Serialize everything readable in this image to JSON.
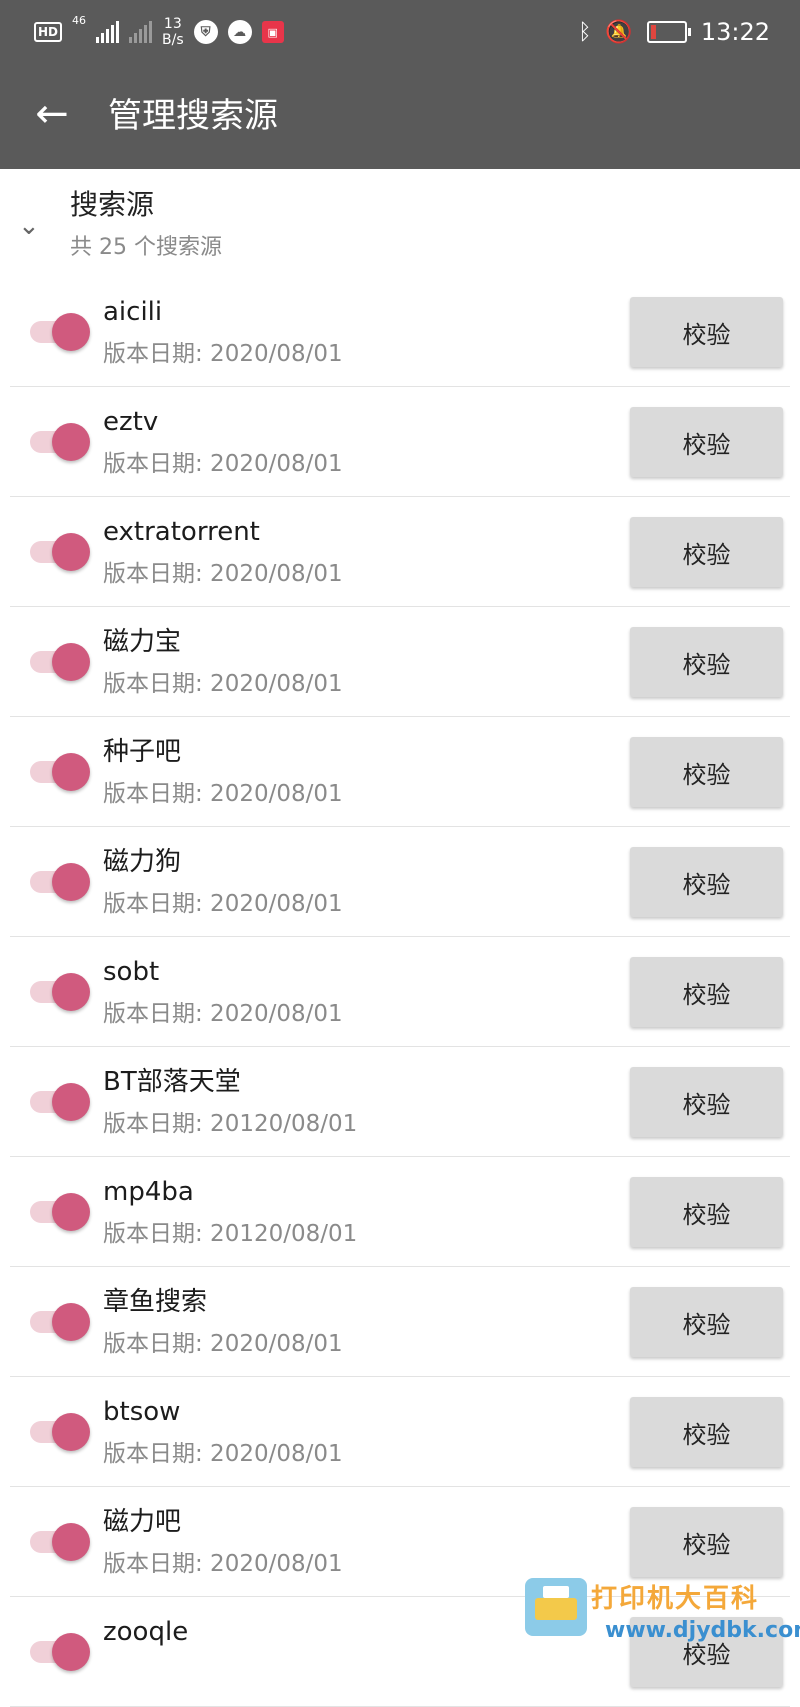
{
  "status_bar": {
    "hd": "HD",
    "net": "46",
    "speed_value": "13",
    "speed_unit": "B/s",
    "time": "13:22",
    "icons": [
      "hd-icon",
      "signal-icon",
      "no-signal-icon",
      "shield-icon",
      "cloud-icon",
      "store-icon",
      "bluetooth-icon",
      "bell-off-icon",
      "battery-icon"
    ]
  },
  "app_bar": {
    "title": "管理搜索源",
    "back_icon": "arrow-left-icon"
  },
  "section": {
    "title": "搜索源",
    "subtitle": "共 25 个搜索源",
    "chevron_icon": "chevron-down-icon"
  },
  "colors": {
    "toolbar": "#5a5a5a",
    "toggle_on": "#d05a7e",
    "toggle_track": "#f0d0d8",
    "button_bg": "#dadada"
  },
  "sources": [
    {
      "name": "aicili",
      "date": "版本日期: 2020/08/01",
      "enabled": true,
      "button": "校验"
    },
    {
      "name": "eztv",
      "date": "版本日期: 2020/08/01",
      "enabled": true,
      "button": "校验"
    },
    {
      "name": "extratorrent",
      "date": "版本日期: 2020/08/01",
      "enabled": true,
      "button": "校验"
    },
    {
      "name": "磁力宝",
      "date": "版本日期: 2020/08/01",
      "enabled": true,
      "button": "校验"
    },
    {
      "name": "种子吧",
      "date": "版本日期: 2020/08/01",
      "enabled": true,
      "button": "校验"
    },
    {
      "name": "磁力狗",
      "date": "版本日期: 2020/08/01",
      "enabled": true,
      "button": "校验"
    },
    {
      "name": "sobt",
      "date": "版本日期: 2020/08/01",
      "enabled": true,
      "button": "校验"
    },
    {
      "name": "BT部落天堂",
      "date": "版本日期: 20120/08/01",
      "enabled": true,
      "button": "校验"
    },
    {
      "name": "mp4ba",
      "date": "版本日期: 20120/08/01",
      "enabled": true,
      "button": "校验"
    },
    {
      "name": "章鱼搜索",
      "date": "版本日期: 2020/08/01",
      "enabled": true,
      "button": "校验"
    },
    {
      "name": "btsow",
      "date": "版本日期: 2020/08/01",
      "enabled": true,
      "button": "校验"
    },
    {
      "name": "磁力吧",
      "date": "版本日期: 2020/08/01",
      "enabled": true,
      "button": "校验"
    },
    {
      "name": "zooqle",
      "date": "",
      "enabled": true,
      "button": "校验"
    }
  ],
  "watermark": {
    "line1": "打印机大百科",
    "line2": "www.djydbk.com"
  }
}
